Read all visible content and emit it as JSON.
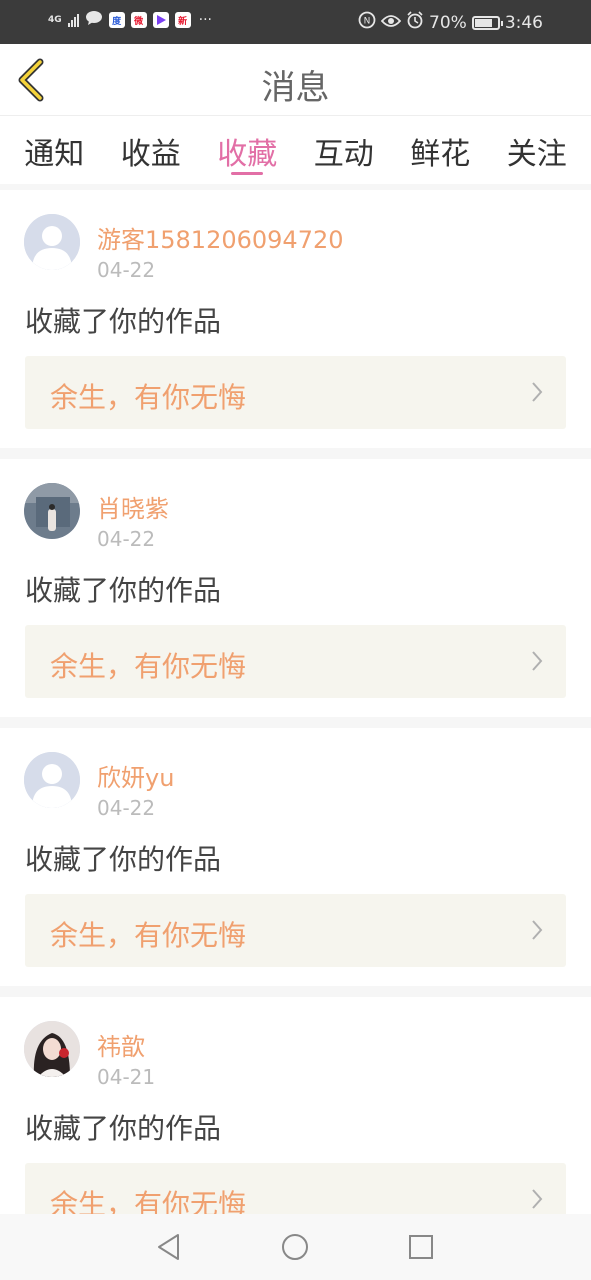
{
  "status_bar": {
    "network": "4G",
    "battery_percent": "70%",
    "battery_level": 0.7,
    "time": "3:46",
    "icons": [
      "signal-icon",
      "message-icon",
      "baidu-icon",
      "weibo-icon",
      "video-icon",
      "sina-icon",
      "more-dots",
      "nfc-icon",
      "eye-icon",
      "alarm-icon",
      "battery-icon"
    ]
  },
  "header": {
    "title": "消息",
    "back_icon": "chevron-left-icon"
  },
  "tabs": [
    {
      "label": "通知"
    },
    {
      "label": "收益"
    },
    {
      "label": "收藏",
      "active": true
    },
    {
      "label": "互动"
    },
    {
      "label": "鲜花"
    },
    {
      "label": "关注"
    }
  ],
  "messages": [
    {
      "user": "游客1581206094720",
      "date": "04-22",
      "action": "收藏了你的作品",
      "work": "余生，有你无悔",
      "avatar": "default"
    },
    {
      "user": "肖晓紫",
      "date": "04-22",
      "action": "收藏了你的作品",
      "work": "余生，有你无悔",
      "avatar": "photo"
    },
    {
      "user": "欣妍yu",
      "date": "04-22",
      "action": "收藏了你的作品",
      "work": "余生，有你无悔",
      "avatar": "default"
    },
    {
      "user": "祎歆",
      "date": "04-21",
      "action": "收藏了你的作品",
      "work": "余生，有你无悔",
      "avatar": "photo"
    }
  ],
  "colors": {
    "accent": "#e26fa6",
    "username": "#f0a06f",
    "work_bg": "#f6f5ee"
  }
}
